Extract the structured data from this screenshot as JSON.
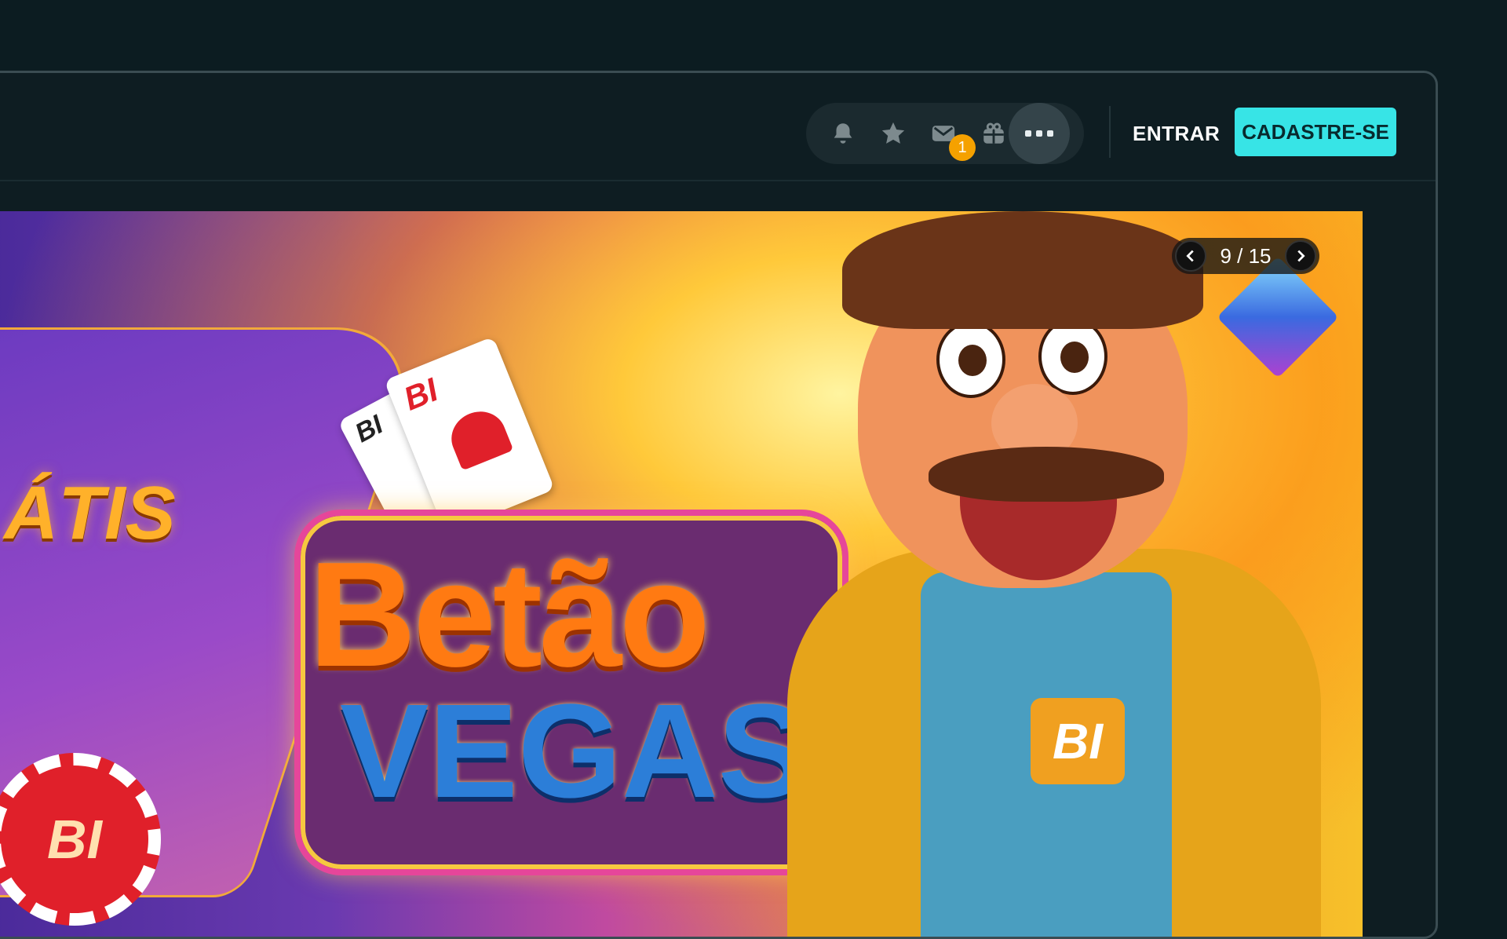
{
  "header": {
    "icons": [
      {
        "name": "bell-icon"
      },
      {
        "name": "star-icon"
      },
      {
        "name": "mail-icon"
      },
      {
        "name": "gift-icon"
      }
    ],
    "notification_count": "1",
    "more_icon": "more-horizontal-icon",
    "login_label": "ENTRAR",
    "signup_label": "CADASTRE-SE"
  },
  "banner": {
    "partial_headline": "ÁTIS",
    "logo_line1": "Betão",
    "logo_line2": "VEGAS",
    "card_text": "BI",
    "chip_text": "BI",
    "shirt_text": "BI",
    "pager": {
      "current": 9,
      "total": 15,
      "label": "9 / 15"
    }
  },
  "colors": {
    "background": "#0c1c21",
    "accent": "#37e4e6",
    "badge": "#f5a100"
  }
}
